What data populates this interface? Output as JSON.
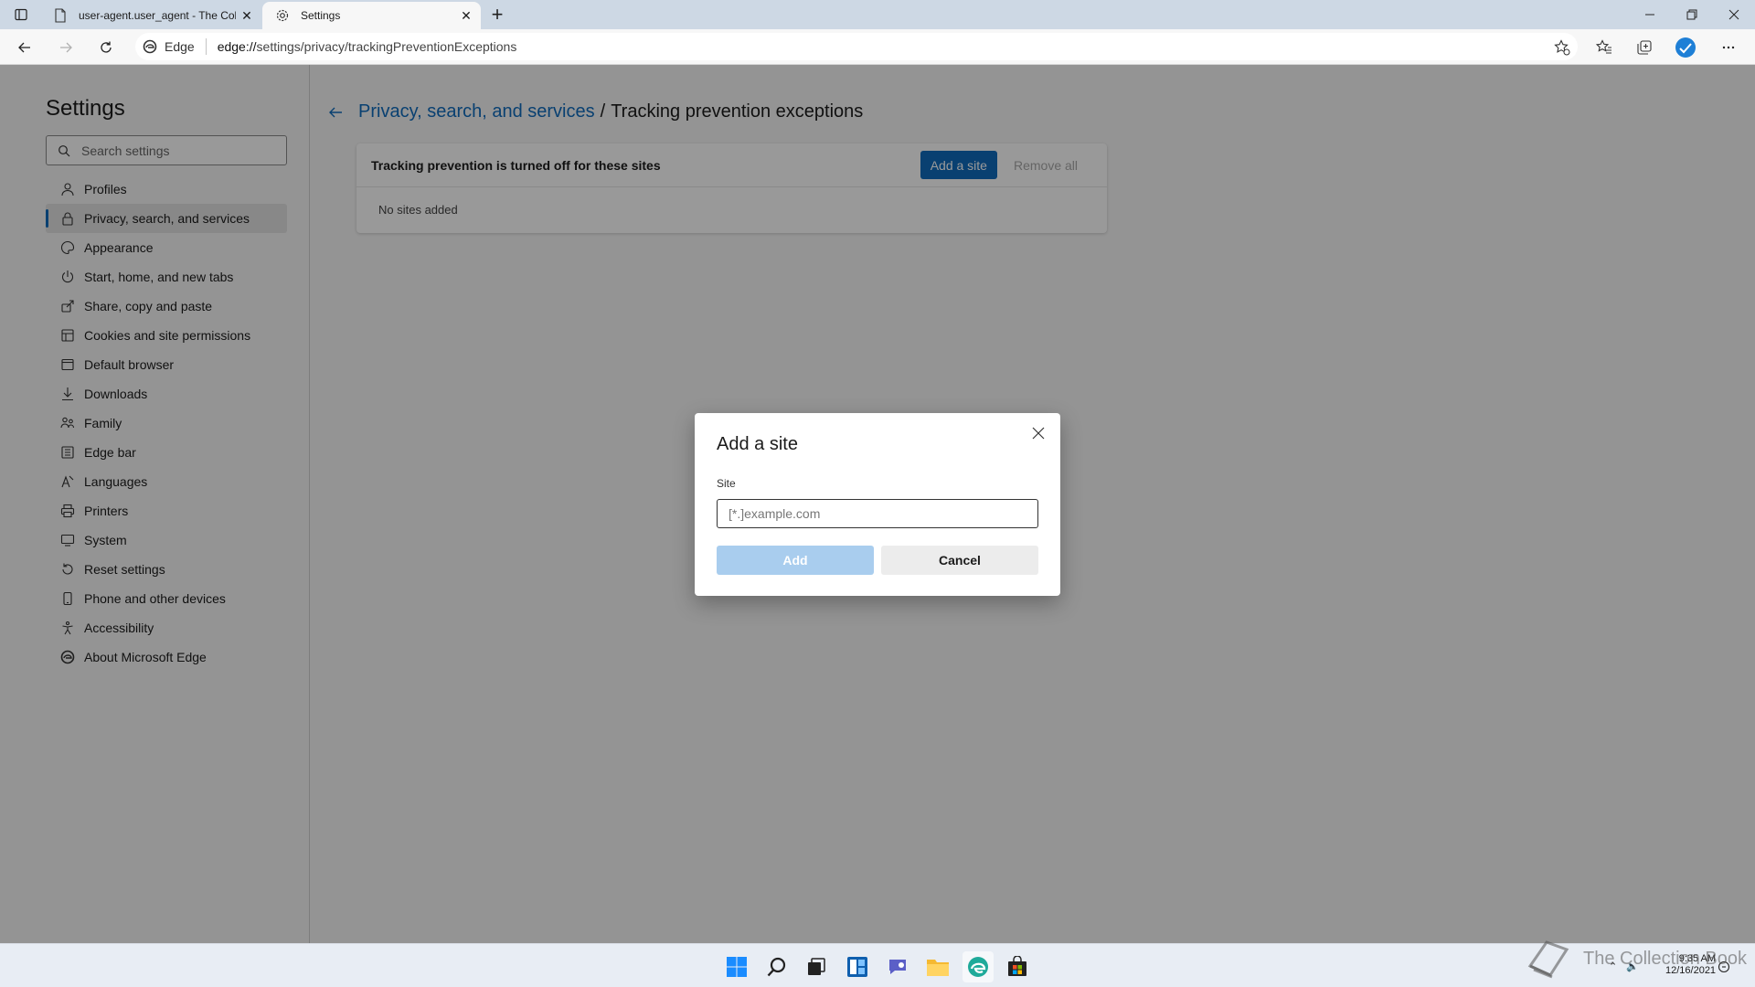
{
  "browser": {
    "tabs": [
      {
        "title": "user-agent.user_agent - The Col",
        "active": false,
        "icon": "page-icon"
      },
      {
        "title": "Settings",
        "active": true,
        "icon": "gear-icon"
      }
    ],
    "address": {
      "badge": "Edge",
      "url_prefix": "edge://",
      "url_rest": "settings/privacy/trackingPreventionExceptions"
    }
  },
  "sidebar": {
    "title": "Settings",
    "search_placeholder": "Search settings",
    "items": [
      {
        "label": "Profiles",
        "icon": "profile-icon"
      },
      {
        "label": "Privacy, search, and services",
        "icon": "lock-icon",
        "active": true
      },
      {
        "label": "Appearance",
        "icon": "appearance-icon"
      },
      {
        "label": "Start, home, and new tabs",
        "icon": "power-icon"
      },
      {
        "label": "Share, copy and paste",
        "icon": "share-icon"
      },
      {
        "label": "Cookies and site permissions",
        "icon": "cookies-icon"
      },
      {
        "label": "Default browser",
        "icon": "browser-icon"
      },
      {
        "label": "Downloads",
        "icon": "download-icon"
      },
      {
        "label": "Family",
        "icon": "family-icon"
      },
      {
        "label": "Edge bar",
        "icon": "edge-bar-icon"
      },
      {
        "label": "Languages",
        "icon": "languages-icon"
      },
      {
        "label": "Printers",
        "icon": "printer-icon"
      },
      {
        "label": "System",
        "icon": "system-icon"
      },
      {
        "label": "Reset settings",
        "icon": "reset-icon"
      },
      {
        "label": "Phone and other devices",
        "icon": "phone-icon"
      },
      {
        "label": "Accessibility",
        "icon": "accessibility-icon"
      },
      {
        "label": "About Microsoft Edge",
        "icon": "edge-logo-icon"
      }
    ]
  },
  "main": {
    "breadcrumb_parent": "Privacy, search, and services",
    "breadcrumb_sep": "/",
    "breadcrumb_current": "Tracking prevention exceptions",
    "card_title": "Tracking prevention is turned off for these sites",
    "add_site_label": "Add a site",
    "remove_all_label": "Remove all",
    "empty_text": "No sites added"
  },
  "dialog": {
    "title": "Add a site",
    "field_label": "Site",
    "placeholder": "[*.]example.com",
    "value": "",
    "add_label": "Add",
    "cancel_label": "Cancel"
  },
  "taskbar": {
    "time": "9:35 AM",
    "date": "12/16/2021",
    "watermark": "The Collection Book"
  },
  "colors": {
    "accent": "#0f6cbd",
    "add_disabled": "#a9cdee"
  }
}
